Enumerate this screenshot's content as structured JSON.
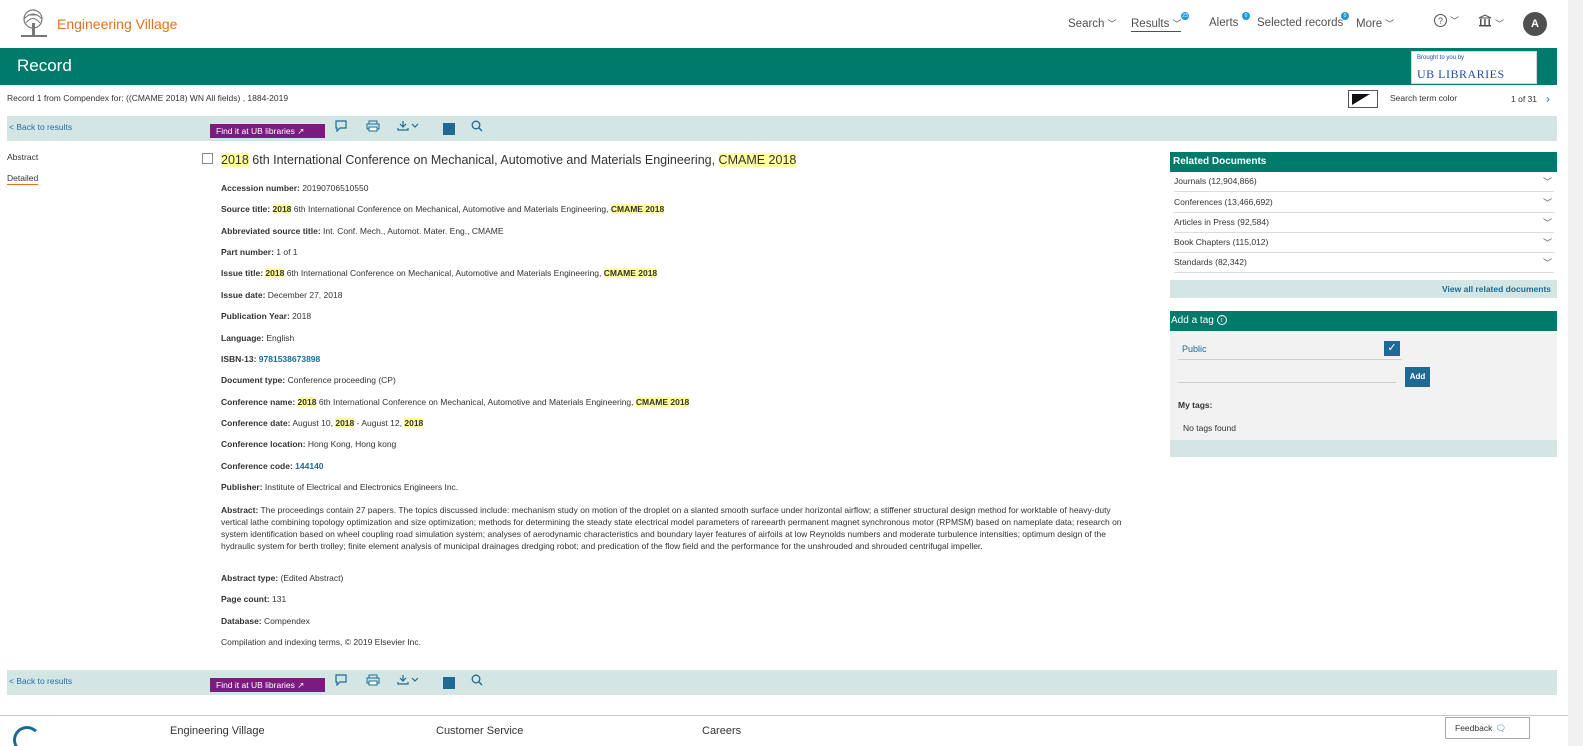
{
  "header": {
    "brand": "Engineering Village",
    "nav": [
      {
        "label": "Search",
        "badge": ""
      },
      {
        "label": "Results",
        "badge": "23"
      },
      {
        "label": "Alerts",
        "badge": "0"
      },
      {
        "label": "Selected records",
        "badge": "0"
      },
      {
        "label": "More",
        "badge": ""
      }
    ],
    "help_glyph": "?",
    "avatar_initial": "A"
  },
  "banner": {
    "title": "Record",
    "library_small": "Brought to you by",
    "library_big": "UB LIBRARIES"
  },
  "record_info": "Record 1 from Compendex for: ((CMAME 2018) WN All fields) , 1884-2019",
  "search_term_color": "Search term color",
  "pager": "1 of 31",
  "toolbar": {
    "back": "< Back to results",
    "find": "Find it at UB libraries ↗"
  },
  "tabs": {
    "abstract": "Abstract",
    "detailed": "Detailed"
  },
  "record": {
    "title_hl1": "2018",
    "title_mid": " 6th International Conference on Mechanical, Automotive and Materials Engineering, ",
    "title_hl2": "CMAME 2018",
    "accession_label": "Accession number:",
    "accession": " 20190706510550",
    "source_label": "Source title:",
    "source_hl1": "2018",
    "source_mid": " 6th International Conference on Mechanical, Automotive and Materials Engineering, ",
    "source_hl2": "CMAME 2018",
    "abbrev_label": "Abbreviated source title:",
    "abbrev": " Int. Conf. Mech., Automot. Mater. Eng., CMAME",
    "part_label": "Part number:",
    "part": " 1 of 1",
    "issue_title_label": "Issue title:",
    "issue_hl1": "2018",
    "issue_mid": " 6th International Conference on Mechanical, Automotive and Materials Engineering, ",
    "issue_hl2": "CMAME 2018",
    "issue_date_label": "Issue date:",
    "issue_date": " December 27, 2018",
    "pubyear_label": "Publication Year:",
    "pubyear": " 2018",
    "language_label": "Language:",
    "language": " English",
    "isbn_label": "ISBN-13:",
    "isbn": " 9781538673898",
    "doctype_label": "Document type:",
    "doctype": " Conference proceeding (CP)",
    "confname_label": "Conference name:",
    "conf_hl1": "2018",
    "conf_mid": " 6th International Conference on Mechanical, Automotive and Materials Engineering, ",
    "conf_hl2": "CMAME 2018",
    "confdate_label": "Conference date:",
    "confdate_a": " August 10, ",
    "confdate_hl1": "2018",
    "confdate_b": " - August 12, ",
    "confdate_hl2": "2018",
    "confloc_label": "Conference location:",
    "confloc": " Hong Kong, Hong kong",
    "confcode_label": "Conference code:",
    "confcode": " 144140",
    "publisher_label": "Publisher:",
    "publisher": " Institute of Electrical and Electronics Engineers Inc.",
    "abstract_label": "Abstract:",
    "abstract": " The proceedings contain 27 papers. The topics discussed include: mechanism study on motion of the droplet on a slanted smooth surface under horizontal airflow; a stiffener structural design method for worktable of heavy-duty vertical lathe combining topology optimization and size optimization; methods for determining the steady state electrical model parameters of rareearth permanent magnet synchronous motor (RPMSM) based on nameplate data; research on system identification based on wheel coupling road simulation system; analyses of aerodynamic characteristics and boundary layer features of airfoils at low Reynolds numbers and moderate turbulence intensities; optimum design of the hydraulic system for berth trolley; finite element analysis of municipal drainages dredging robot; and predication of the flow field and the performance for the unshrouded and shrouded centrifugal impeller.",
    "abstype_label": "Abstract type:",
    "abstype": " (Edited Abstract)",
    "pagecount_label": "Page count:",
    "pagecount": " 131",
    "database_label": "Database:",
    "database": " Compendex",
    "copyright": "Compilation and indexing terms, © 2019 Elsevier Inc."
  },
  "related": {
    "title": "Related Documents",
    "items": [
      "Journals (12,904,866)",
      "Conferences (13,466,692)",
      "Articles in Press (92,584)",
      "Book Chapters (115,012)",
      "Standards (82,342)"
    ],
    "view_all": "View all related documents"
  },
  "tags": {
    "title": "Add a tag",
    "public": "Public",
    "add": "Add",
    "my_tags": "My tags:",
    "none": "No tags found"
  },
  "footer": {
    "links": [
      "Engineering Village",
      "Customer Service",
      "Careers"
    ],
    "feedback": "Feedback"
  },
  "colors": {
    "brand_orange": "#e9711c",
    "header_green": "#007a6a",
    "link_blue": "#1d6a95",
    "find_purple": "#7a1b80",
    "highlight": "#ffff9f"
  }
}
